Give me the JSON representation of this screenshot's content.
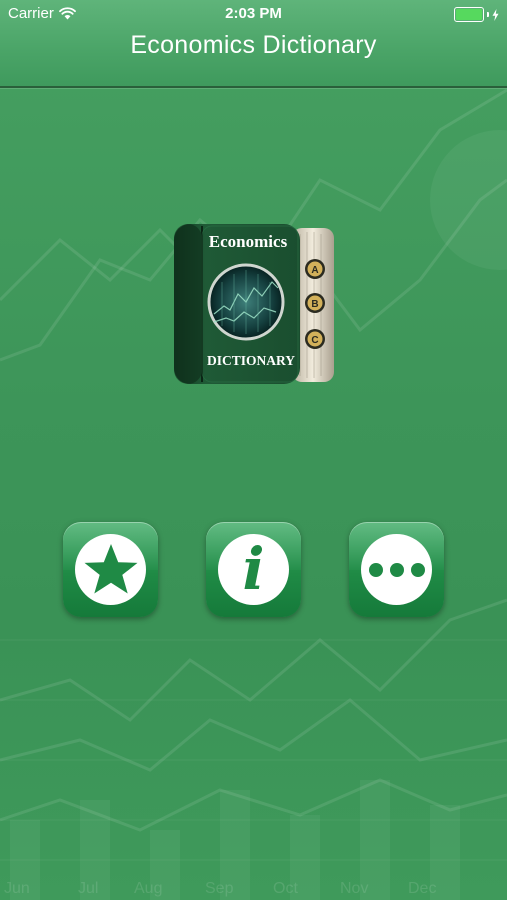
{
  "status_bar": {
    "carrier": "Carrier",
    "time": "2:03 PM",
    "battery_level": 1.0
  },
  "nav_bar": {
    "title": "Economics Dictionary"
  },
  "app_icon": {
    "top_text": "Economics",
    "bottom_text": "DICTIONARY",
    "tabs": [
      "A",
      "B",
      "C"
    ]
  },
  "actions": [
    {
      "name": "favorites",
      "icon": "star-icon"
    },
    {
      "name": "info",
      "icon": "info-icon"
    },
    {
      "name": "more",
      "icon": "more-dots-icon"
    }
  ],
  "background_chart": {
    "months": [
      "Jun",
      "Jul",
      "Aug",
      "Sep",
      "Oct",
      "Nov",
      "Dec"
    ]
  },
  "colors": {
    "background": "#3f955a",
    "nav_bar": "#4aa467",
    "button": "#1f8a45",
    "book_cover": "#1f5a36",
    "battery": "#56d95e"
  }
}
